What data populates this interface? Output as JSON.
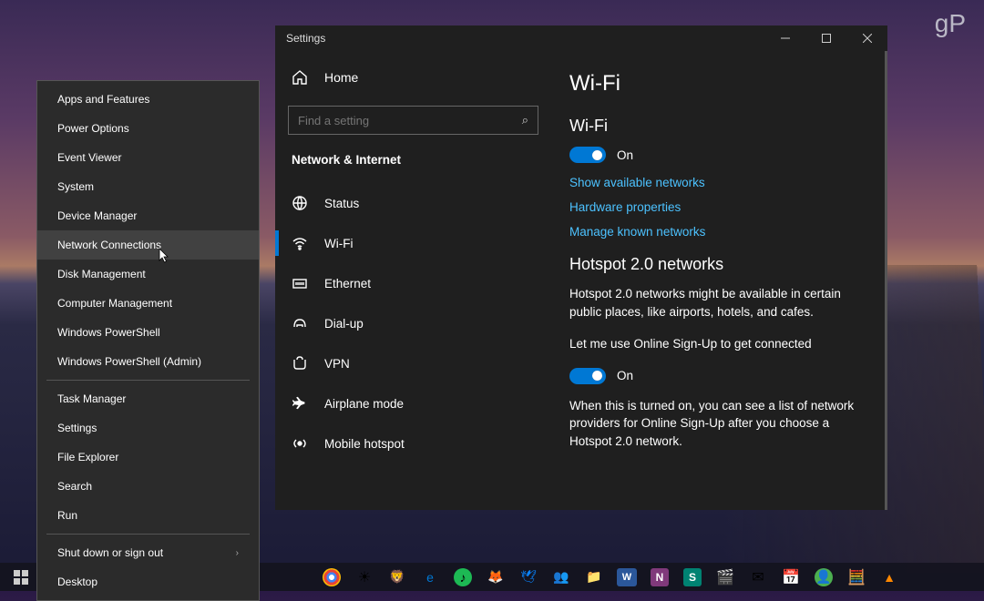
{
  "watermark": "gP",
  "winx": {
    "items_top": [
      "Apps and Features",
      "Power Options",
      "Event Viewer",
      "System",
      "Device Manager",
      "Network Connections",
      "Disk Management",
      "Computer Management",
      "Windows PowerShell",
      "Windows PowerShell (Admin)"
    ],
    "items_mid": [
      "Task Manager",
      "Settings",
      "File Explorer",
      "Search",
      "Run"
    ],
    "items_bot": [
      "Shut down or sign out",
      "Desktop"
    ],
    "hovered_index": 5
  },
  "settings": {
    "window_title": "Settings",
    "home": "Home",
    "search_placeholder": "Find a setting",
    "section_header": "Network & Internet",
    "nav_items": [
      {
        "icon": "status",
        "label": "Status"
      },
      {
        "icon": "wifi",
        "label": "Wi-Fi",
        "active": true
      },
      {
        "icon": "ethernet",
        "label": "Ethernet"
      },
      {
        "icon": "dialup",
        "label": "Dial-up"
      },
      {
        "icon": "vpn",
        "label": "VPN"
      },
      {
        "icon": "airplane",
        "label": "Airplane mode"
      },
      {
        "icon": "hotspot",
        "label": "Mobile hotspot"
      }
    ],
    "content": {
      "title": "Wi-Fi",
      "wifi_heading": "Wi-Fi",
      "wifi_on": "On",
      "links": [
        "Show available networks",
        "Hardware properties",
        "Manage known networks"
      ],
      "hotspot_heading": "Hotspot 2.0 networks",
      "hotspot_desc": "Hotspot 2.0 networks might be available in certain public places, like airports, hotels, and cafes.",
      "online_signup_label": "Let me use Online Sign-Up to get connected",
      "online_signup_on": "On",
      "online_signup_desc": "When this is turned on, you can see a list of network providers for Online Sign-Up after you choose a Hotspot 2.0 network."
    }
  }
}
